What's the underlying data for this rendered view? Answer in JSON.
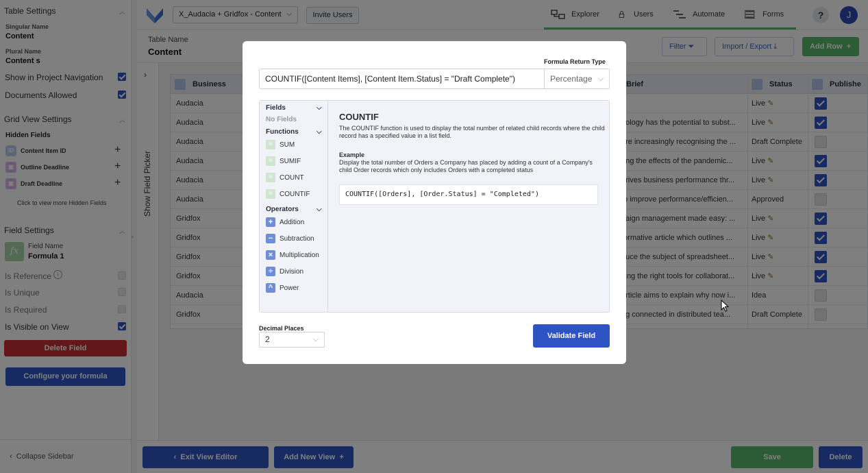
{
  "colors": {
    "accent": "#2e54c4",
    "success": "#56b96a",
    "danger": "#c53030"
  },
  "topbar": {
    "project_select": "X_Audacia + Gridfox - Content",
    "invite_label": "Invite Users",
    "nav": [
      {
        "label": "Explorer",
        "icon": "explorer-icon"
      },
      {
        "label": "Users",
        "icon": "lock-icon"
      },
      {
        "label": "Automate",
        "icon": "automate-icon"
      },
      {
        "label": "Forms",
        "icon": "forms-icon"
      }
    ],
    "help_label": "?",
    "avatar_initial": "J"
  },
  "sidebar": {
    "table_settings_title": "Table Settings",
    "singular_name_label": "Singular Name",
    "singular_name_value": "Content",
    "plural_name_label": "Plural Name",
    "plural_name_value": "Content s",
    "show_in_nav_label": "Show in Project Navigation",
    "documents_allowed_label": "Documents Allowed",
    "grid_view_settings_title": "Grid View Settings",
    "hidden_fields_label": "Hidden Fields",
    "hidden_fields": [
      "Content Item ID",
      "Outline Deadline",
      "Draft Deadline"
    ],
    "more_hidden_fields": "Click to view more Hidden Fields",
    "field_settings_title": "Field Settings",
    "field_name_label": "Field Name",
    "field_name_value": "Formula 1",
    "is_reference_label": "Is Reference",
    "is_unique_label": "Is Unique",
    "is_required_label": "Is Required",
    "is_visible_label": "Is Visible on View",
    "delete_field_label": "Delete Field",
    "configure_formula_label": "Configure your formula",
    "collapse_label": "Collapse Sidebar"
  },
  "subheader": {
    "table_name_label": "Table Name",
    "table_name_value": "Content",
    "filter_label": "Filter",
    "import_export_label": "Import / Export",
    "add_row_label": "Add Row"
  },
  "field_picker_label": "Show Field Picker",
  "grid": {
    "columns": [
      "Business",
      "Brief",
      "Status",
      "Publishe"
    ],
    "rows": [
      {
        "business": "Audacia",
        "brief": "",
        "status": "Live",
        "published": true
      },
      {
        "business": "Audacia",
        "brief": "nology has the potential to subst...",
        "status": "Live",
        "published": true
      },
      {
        "business": "Audacia",
        "brief": "are increasingly recognising the ...",
        "status": "Draft Complete",
        "published": false
      },
      {
        "business": "Audacia",
        "brief": "ring the effects of the pandemic...",
        "status": "Live",
        "published": true
      },
      {
        "business": "Audacia",
        "brief": "drives business performance thr...",
        "status": "Live",
        "published": true
      },
      {
        "business": "Audacia",
        "brief": "to improve performance/efficien...",
        "status": "Approved",
        "published": false
      },
      {
        "business": "Gridfox",
        "brief": "paign management made easy: ...",
        "status": "Live",
        "published": true
      },
      {
        "business": "Gridfox",
        "brief": "formative article which outlines ...",
        "status": "Live",
        "published": true
      },
      {
        "business": "Gridfox",
        "brief": "duce the subject of spreadsheet...",
        "status": "Live",
        "published": true
      },
      {
        "business": "Gridfox",
        "brief": "sing the right tools for collaborat...",
        "status": "Live",
        "published": true
      },
      {
        "business": "Audacia",
        "brief": "article aims to explain why now i...",
        "status": "Idea",
        "published": false
      },
      {
        "business": "Gridfox",
        "brief": "ng connected in distributed tea...",
        "status": "Draft Complete",
        "published": false
      }
    ]
  },
  "bottombar": {
    "exit_label": "Exit View Editor",
    "add_view_label": "Add New View",
    "save_label": "Save",
    "delete_label": "Delete"
  },
  "modal": {
    "return_type_label": "Formula Return Type",
    "formula_value": "COUNTIF([Content Items], [Content Item.Status] = \"Draft Complete\")",
    "return_type_value": "Percentage",
    "fields_label": "Fields",
    "no_fields": "No Fields",
    "functions_label": "Functions",
    "functions": [
      "SUM",
      "SUMIF",
      "COUNT",
      "COUNTIF"
    ],
    "operators_label": "Operators",
    "operators": [
      {
        "label": "Addition",
        "symbol": "+"
      },
      {
        "label": "Subtraction",
        "symbol": "−"
      },
      {
        "label": "Multiplication",
        "symbol": "×"
      },
      {
        "label": "Division",
        "symbol": "÷"
      },
      {
        "label": "Power",
        "symbol": "^"
      }
    ],
    "fn_title": "COUNTIF",
    "fn_description": "The COUNTIF function is used to display the total number of related child records where the child record has a specified value in a list field.",
    "example_label": "Example",
    "example_text": "Display the total number of Orders a Company has placed by adding a count of a Company's child Order records which only includes Orders with a completed status",
    "example_code": "COUNTIF([Orders], [Order.Status] = \"Completed\")",
    "decimal_places_label": "Decimal Places",
    "decimal_places_value": "2",
    "validate_label": "Validate Field"
  }
}
